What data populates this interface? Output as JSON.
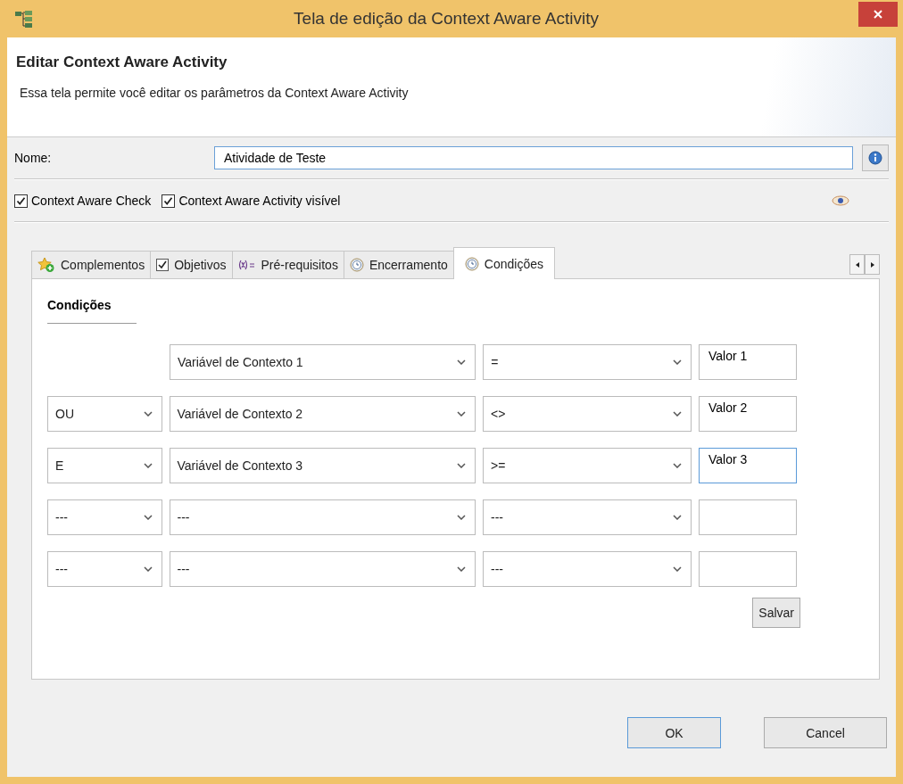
{
  "window": {
    "title": "Tela de edição da Context Aware Activity"
  },
  "header": {
    "title": "Editar Context Aware Activity",
    "description": "Essa tela permite você editar os parâmetros da Context Aware Activity"
  },
  "name_field": {
    "label": "Nome:",
    "value": "Atividade de Teste"
  },
  "checkboxes": [
    {
      "label": "Context Aware Check",
      "checked": true
    },
    {
      "label": "Context Aware Activity visível",
      "checked": true
    }
  ],
  "tabs": [
    {
      "label": "Complementos",
      "kind": "star",
      "selected": false
    },
    {
      "label": "Objetivos",
      "kind": "check",
      "selected": false
    },
    {
      "label": "Pré-requisitos",
      "kind": "variable",
      "selected": false
    },
    {
      "label": "Encerramento",
      "kind": "clock",
      "selected": false
    },
    {
      "label": "Condições",
      "kind": "clock",
      "selected": true
    }
  ],
  "section_title": "Condições",
  "conditions": [
    {
      "variable": "Variável de Contexto 1",
      "operator": "=",
      "value": "Valor 1",
      "focused": false
    },
    {
      "connector": "OU",
      "variable": "Variável de Contexto 2",
      "operator": "<>",
      "value": "Valor 2",
      "focused": false
    },
    {
      "connector": "E",
      "variable": "Variável de Contexto 3",
      "operator": ">=",
      "value": "Valor 3",
      "focused": true
    },
    {
      "connector": "---",
      "variable": "---",
      "operator": "---",
      "focused": false
    },
    {
      "connector": "---",
      "variable": "---",
      "operator": "---",
      "focused": false
    }
  ],
  "save_button": "Salvar",
  "buttons": [
    {
      "label": "OK",
      "default": true
    },
    {
      "label": "Cancel",
      "default": false
    }
  ]
}
